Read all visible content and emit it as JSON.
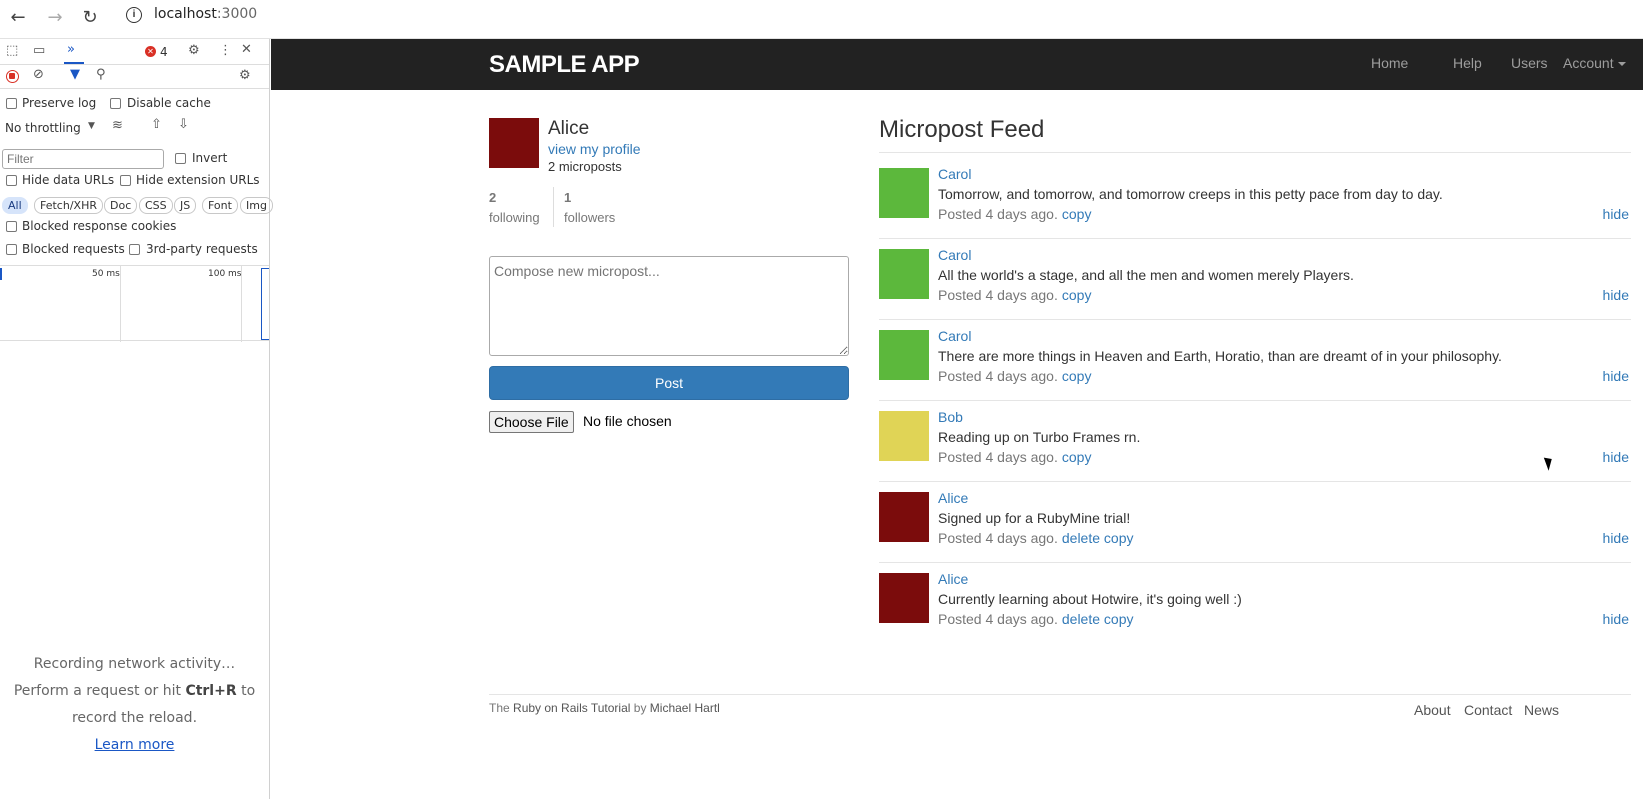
{
  "browser": {
    "url_host": "localhost",
    "url_port": ":3000"
  },
  "devtools": {
    "error_count": "4",
    "preserve_log": "Preserve log",
    "disable_cache": "Disable cache",
    "throttling": "No throttling",
    "filter_placeholder": "Filter",
    "invert": "Invert",
    "hide_data_urls": "Hide data URLs",
    "hide_extension_urls": "Hide extension URLs",
    "chips": [
      "All",
      "Fetch/XHR",
      "Doc",
      "CSS",
      "JS",
      "Font",
      "Img"
    ],
    "blocked_cookies": "Blocked response cookies",
    "blocked_requests": "Blocked requests",
    "third_party": "3rd-party requests",
    "tick_50": "50 ms",
    "tick_100": "100 ms",
    "recording_line1": "Recording network activity…",
    "recording_line2_pre": "Perform a request or hit ",
    "recording_shortcut": "Ctrl+R",
    "recording_line2_post": " to",
    "recording_line3": "record the reload.",
    "learn_more": "Learn more"
  },
  "app": {
    "logo": "SAMPLE APP",
    "nav": [
      "Home",
      "Help",
      "Users",
      "Account"
    ],
    "user": {
      "name": "Alice",
      "profile_link": "view my profile",
      "microposts": "2 microposts",
      "avatar_color": "#7b0c0c"
    },
    "stats": {
      "following_count": "2",
      "following_label": "following",
      "followers_count": "1",
      "followers_label": "followers"
    },
    "compose_placeholder": "Compose new micropost...",
    "post_button": "Post",
    "file_button": "Choose File",
    "file_status": "No file chosen",
    "feed_title": "Micropost Feed",
    "feed": [
      {
        "user": "Carol",
        "content": "Tomorrow, and tomorrow, and tomorrow creeps in this petty pace from day to day.",
        "posted": "Posted 4 days ago.",
        "actions": "copy",
        "hide": "hide",
        "avatar_color": "#5cb83c"
      },
      {
        "user": "Carol",
        "content": "All the world's a stage, and all the men and women merely Players.",
        "posted": "Posted 4 days ago.",
        "actions": "copy",
        "hide": "hide",
        "avatar_color": "#5cb83c"
      },
      {
        "user": "Carol",
        "content": "There are more things in Heaven and Earth, Horatio, than are dreamt of in your philosophy.",
        "posted": "Posted 4 days ago.",
        "actions": "copy",
        "hide": "hide",
        "avatar_color": "#5cb83c"
      },
      {
        "user": "Bob",
        "content": "Reading up on Turbo Frames rn.",
        "posted": "Posted 4 days ago.",
        "actions": "copy",
        "hide": "hide",
        "avatar_color": "#e0d456"
      },
      {
        "user": "Alice",
        "content": "Signed up for a RubyMine trial!",
        "posted": "Posted 4 days ago.",
        "actions": "delete copy",
        "hide": "hide",
        "avatar_color": "#7b0c0c"
      },
      {
        "user": "Alice",
        "content": "Currently learning about Hotwire, it's going well :)",
        "posted": "Posted 4 days ago.",
        "actions": "delete copy",
        "hide": "hide",
        "avatar_color": "#7b0c0c"
      }
    ],
    "footer": {
      "credit_the": "The",
      "credit_link": "Ruby on Rails Tutorial",
      "credit_by": "by",
      "credit_author": "Michael Hartl",
      "links": [
        "About",
        "Contact",
        "News"
      ]
    }
  }
}
